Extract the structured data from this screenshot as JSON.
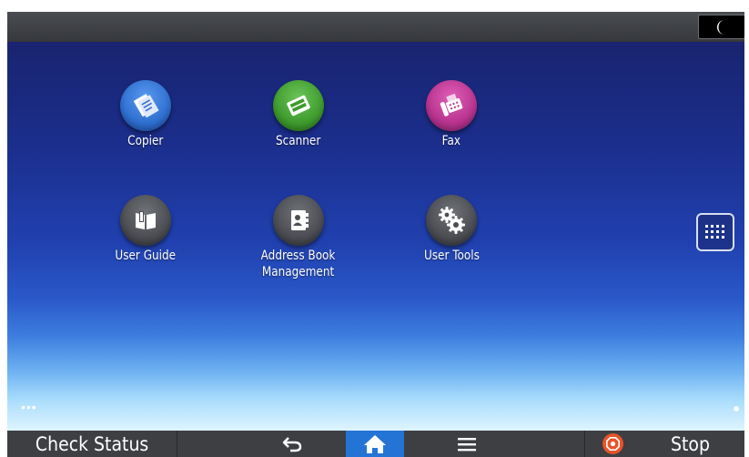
{
  "status_bar": {
    "sleep_icon": "moon-icon"
  },
  "apps": [
    {
      "label": "Copier",
      "icon": "copier-icon",
      "color": "#2f6fd0"
    },
    {
      "label": "Scanner",
      "icon": "scanner-icon",
      "color": "#3f9b2d"
    },
    {
      "label": "Fax",
      "icon": "fax-icon",
      "color": "#b8338f"
    },
    {
      "label": "User Guide",
      "icon": "user-guide-icon",
      "color": "#4b4d52"
    },
    {
      "label": "Address Book\nManagement",
      "icon": "address-book-icon",
      "color": "#4b4d52"
    },
    {
      "label": "User Tools",
      "icon": "gear-icon",
      "color": "#4b4d52"
    }
  ],
  "side": {
    "app_list_icon": "grid-icon"
  },
  "bottom_bar": {
    "check_status_label": "Check Status",
    "back_icon": "back-arrow-icon",
    "home_icon": "home-icon",
    "menu_icon": "menu-icon",
    "stop_icon": "stop-icon",
    "stop_label": "Stop"
  },
  "colors": {
    "home_active": "#2474d6",
    "stop": "#e8542a"
  }
}
